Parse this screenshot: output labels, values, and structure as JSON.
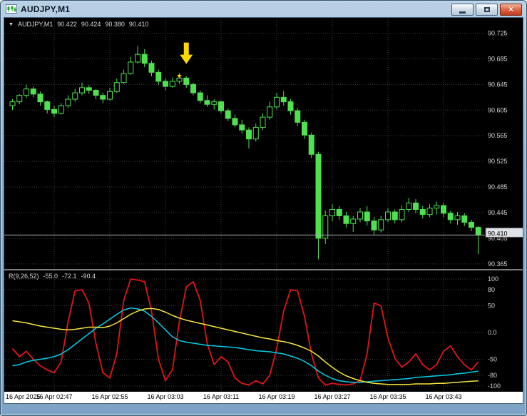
{
  "window": {
    "title": "AUDJPY,M1",
    "controls": {
      "close_glyph": "×"
    }
  },
  "colors": {
    "candle": "#50e050",
    "grid": "#3e3e3e",
    "bid_line": "#aab2ba",
    "axis_text": "#d4d4d4",
    "red_line": "#e01515",
    "cyan_line": "#00cfe8",
    "yellow_line": "#f5e43c",
    "annotation_yellow": "#ffd800"
  },
  "chart": {
    "symbol_line": {
      "triangle_glyph": "▼",
      "symbol": "AUDJPY,M1",
      "open": "90.422",
      "high": "90.424",
      "low": "90.380",
      "close": "90.410"
    },
    "price_axis": {
      "current": "90.410",
      "labels": [
        "90.725",
        "90.685",
        "90.645",
        "90.605",
        "90.565",
        "90.525",
        "90.485",
        "90.445",
        "90.405",
        "90.365"
      ]
    }
  },
  "indicator": {
    "label": "R(9,26,52)",
    "values": [
      "-55.0",
      "-72.1",
      "-90.4"
    ],
    "axis_labels": [
      "100",
      "80",
      "50",
      "0.0",
      "-50",
      "-80",
      "-100"
    ]
  },
  "time_axis": {
    "labels": [
      "16 Apr 2025",
      "16 Apr 02:47",
      "16 Apr 02:55",
      "16 Apr 03:03",
      "16 Apr 03:11",
      "16 Apr 03:19",
      "16 Apr 03:27",
      "16 Apr 03:35",
      "16 Apr 03:43"
    ]
  },
  "chart_data": {
    "type": "candlestick",
    "symbol": "AUDJPY",
    "timeframe": "M1",
    "date": "16 Apr 2025",
    "price_range": [
      90.357,
      90.749
    ],
    "price_gridlines": [
      90.725,
      90.685,
      90.645,
      90.605,
      90.565,
      90.525,
      90.485,
      90.445,
      90.405,
      90.365
    ],
    "bid": 90.41,
    "time_gridline_indices": [
      6,
      14,
      22,
      30,
      38,
      46,
      54,
      62
    ],
    "candles": [
      [
        "02:41",
        90.612,
        90.622,
        90.605,
        90.618
      ],
      [
        "02:42",
        90.618,
        90.63,
        90.614,
        90.628
      ],
      [
        "02:43",
        90.628,
        90.645,
        90.624,
        90.638
      ],
      [
        "02:44",
        90.638,
        90.642,
        90.625,
        90.63
      ],
      [
        "02:45",
        90.63,
        90.634,
        90.612,
        90.618
      ],
      [
        "02:46",
        90.618,
        90.62,
        90.6,
        90.606
      ],
      [
        "02:47",
        90.606,
        90.612,
        90.594,
        90.6
      ],
      [
        "02:48",
        90.6,
        90.616,
        90.598,
        90.612
      ],
      [
        "02:49",
        90.612,
        90.628,
        90.608,
        90.622
      ],
      [
        "02:50",
        90.622,
        90.638,
        90.618,
        90.632
      ],
      [
        "02:51",
        90.632,
        90.648,
        90.628,
        90.64
      ],
      [
        "02:52",
        90.64,
        90.644,
        90.63,
        90.636
      ],
      [
        "02:53",
        90.636,
        90.638,
        90.622,
        90.628
      ],
      [
        "02:54",
        90.628,
        90.632,
        90.616,
        90.622
      ],
      [
        "02:55",
        90.622,
        90.64,
        90.62,
        90.634
      ],
      [
        "02:56",
        90.634,
        90.654,
        90.632,
        90.648
      ],
      [
        "02:57",
        90.648,
        90.668,
        90.646,
        90.662
      ],
      [
        "02:58",
        90.662,
        90.688,
        90.66,
        90.68
      ],
      [
        "02:59",
        90.68,
        90.705,
        90.678,
        90.692
      ],
      [
        "03:00",
        90.692,
        90.7,
        90.672,
        90.678
      ],
      [
        "03:01",
        90.678,
        90.682,
        90.658,
        90.664
      ],
      [
        "03:02",
        90.664,
        90.668,
        90.644,
        90.65
      ],
      [
        "03:03",
        90.65,
        90.654,
        90.636,
        90.642
      ],
      [
        "03:04",
        90.642,
        90.656,
        90.64,
        90.65
      ],
      [
        "03:05",
        90.65,
        90.662,
        90.646,
        90.655
      ],
      [
        "03:06",
        90.655,
        90.658,
        90.64,
        90.645
      ],
      [
        "03:07",
        90.645,
        90.648,
        90.628,
        90.632
      ],
      [
        "03:08",
        90.632,
        90.636,
        90.616,
        90.62
      ],
      [
        "03:09",
        90.62,
        90.628,
        90.61,
        90.614
      ],
      [
        "03:10",
        90.614,
        90.622,
        90.606,
        90.618
      ],
      [
        "03:11",
        90.618,
        90.62,
        90.6,
        90.604
      ],
      [
        "03:12",
        90.604,
        90.608,
        90.588,
        90.592
      ],
      [
        "03:13",
        90.592,
        90.598,
        90.578,
        90.582
      ],
      [
        "03:14",
        90.582,
        90.59,
        90.568,
        90.574
      ],
      [
        "03:15",
        90.574,
        90.578,
        90.545,
        90.56
      ],
      [
        "03:16",
        90.56,
        90.584,
        90.556,
        90.578
      ],
      [
        "03:17",
        90.578,
        90.6,
        90.574,
        90.594
      ],
      [
        "03:18",
        90.594,
        90.618,
        90.59,
        90.61
      ],
      [
        "03:19",
        90.61,
        90.632,
        90.606,
        90.625
      ],
      [
        "03:20",
        90.625,
        90.635,
        90.612,
        90.618
      ],
      [
        "03:21",
        90.618,
        90.622,
        90.598,
        90.604
      ],
      [
        "03:22",
        90.604,
        90.608,
        90.58,
        90.586
      ],
      [
        "03:23",
        90.586,
        90.59,
        90.56,
        90.566
      ],
      [
        "03:24",
        90.566,
        90.57,
        90.53,
        90.536
      ],
      [
        "03:25",
        90.536,
        90.54,
        90.372,
        90.405
      ],
      [
        "03:26",
        90.405,
        90.448,
        90.396,
        90.44
      ],
      [
        "03:27",
        90.44,
        90.458,
        90.432,
        90.45
      ],
      [
        "03:28",
        90.45,
        90.455,
        90.434,
        90.44
      ],
      [
        "03:29",
        90.44,
        90.446,
        90.422,
        90.428
      ],
      [
        "03:30",
        90.428,
        90.44,
        90.415,
        90.435
      ],
      [
        "03:31",
        90.435,
        90.452,
        90.43,
        90.446
      ],
      [
        "03:32",
        90.446,
        90.455,
        90.425,
        90.432
      ],
      [
        "03:33",
        90.432,
        90.438,
        90.41,
        90.418
      ],
      [
        "03:34",
        90.418,
        90.44,
        90.414,
        90.434
      ],
      [
        "03:35",
        90.434,
        90.452,
        90.43,
        90.446
      ],
      [
        "03:36",
        90.446,
        90.45,
        90.428,
        90.434
      ],
      [
        "03:37",
        90.434,
        90.456,
        90.43,
        90.45
      ],
      [
        "03:38",
        90.45,
        90.468,
        90.446,
        90.46
      ],
      [
        "03:39",
        90.46,
        90.466,
        90.444,
        90.45
      ],
      [
        "03:40",
        90.45,
        90.455,
        90.436,
        90.442
      ],
      [
        "03:41",
        90.442,
        90.458,
        90.438,
        90.452
      ],
      [
        "03:42",
        90.452,
        90.462,
        90.442,
        90.456
      ],
      [
        "03:43",
        90.456,
        90.46,
        90.438,
        90.444
      ],
      [
        "03:44",
        90.444,
        90.448,
        90.428,
        90.434
      ],
      [
        "03:45",
        90.434,
        90.446,
        90.426,
        90.44
      ],
      [
        "03:46",
        90.44,
        90.444,
        90.424,
        90.43
      ],
      [
        "03:47",
        90.43,
        90.434,
        90.416,
        90.422
      ],
      [
        "03:48",
        90.422,
        90.424,
        90.38,
        90.41
      ]
    ],
    "annotations": [
      {
        "type": "arrow-down",
        "index": 25,
        "price": 90.677,
        "color": "#ffd800"
      },
      {
        "type": "star",
        "index": 24,
        "price": 90.66,
        "color": "#ffd800",
        "glyph": "★"
      }
    ],
    "indicator_pane": {
      "title": "R(9,26,52)",
      "current_values": [
        -55.0,
        -72.1,
        -90.4
      ],
      "range": [
        -100,
        100
      ],
      "levels": [
        100,
        80,
        50,
        0,
        -50,
        -80,
        -100
      ],
      "series": [
        {
          "name": "fast",
          "color_key": "red_line",
          "width": 1.8,
          "values": [
            -30,
            -45,
            -35,
            -50,
            -62,
            -70,
            -75,
            -55,
            20,
            78,
            80,
            55,
            -20,
            -75,
            -85,
            -40,
            60,
            100,
            98,
            95,
            40,
            -50,
            -90,
            -70,
            20,
            85,
            95,
            60,
            -20,
            -60,
            -45,
            -55,
            -85,
            -95,
            -98,
            -90,
            -96,
            -80,
            -30,
            40,
            80,
            78,
            30,
            -40,
            -85,
            -98,
            -95,
            -97,
            -98,
            -96,
            -90,
            -40,
            55,
            50,
            -10,
            -48,
            -65,
            -55,
            -40,
            -60,
            -70,
            -60,
            -35,
            -25,
            -45,
            -60,
            -70,
            -55
          ]
        },
        {
          "name": "mid",
          "color_key": "cyan_line",
          "width": 1.5,
          "values": [
            -62,
            -60,
            -55,
            -52,
            -50,
            -48,
            -45,
            -40,
            -32,
            -22,
            -12,
            -2,
            8,
            16,
            25,
            34,
            42,
            46,
            44,
            40,
            30,
            18,
            5,
            -8,
            -15,
            -18,
            -20,
            -22,
            -24,
            -25,
            -26,
            -27,
            -28,
            -30,
            -32,
            -34,
            -35,
            -36,
            -38,
            -40,
            -44,
            -48,
            -54,
            -62,
            -72,
            -80,
            -86,
            -90,
            -92,
            -93,
            -93,
            -92,
            -91,
            -90,
            -89,
            -88,
            -87,
            -86,
            -84,
            -83,
            -82,
            -81,
            -80,
            -79,
            -77,
            -76,
            -74,
            -72.1
          ]
        },
        {
          "name": "slow",
          "color_key": "yellow_line",
          "width": 1.5,
          "values": [
            22,
            20,
            18,
            15,
            12,
            10,
            8,
            6,
            5,
            6,
            8,
            10,
            10,
            9,
            12,
            18,
            26,
            34,
            40,
            44,
            45,
            43,
            38,
            32,
            27,
            23,
            20,
            17,
            14,
            11,
            8,
            5,
            2,
            -1,
            -4,
            -7,
            -10,
            -12,
            -15,
            -17,
            -20,
            -24,
            -29,
            -35,
            -44,
            -55,
            -65,
            -74,
            -81,
            -86,
            -90,
            -93,
            -95,
            -96,
            -97,
            -97,
            -97,
            -97,
            -96,
            -96,
            -96,
            -95,
            -95,
            -94,
            -93,
            -92,
            -91,
            -90.4
          ]
        }
      ]
    }
  }
}
